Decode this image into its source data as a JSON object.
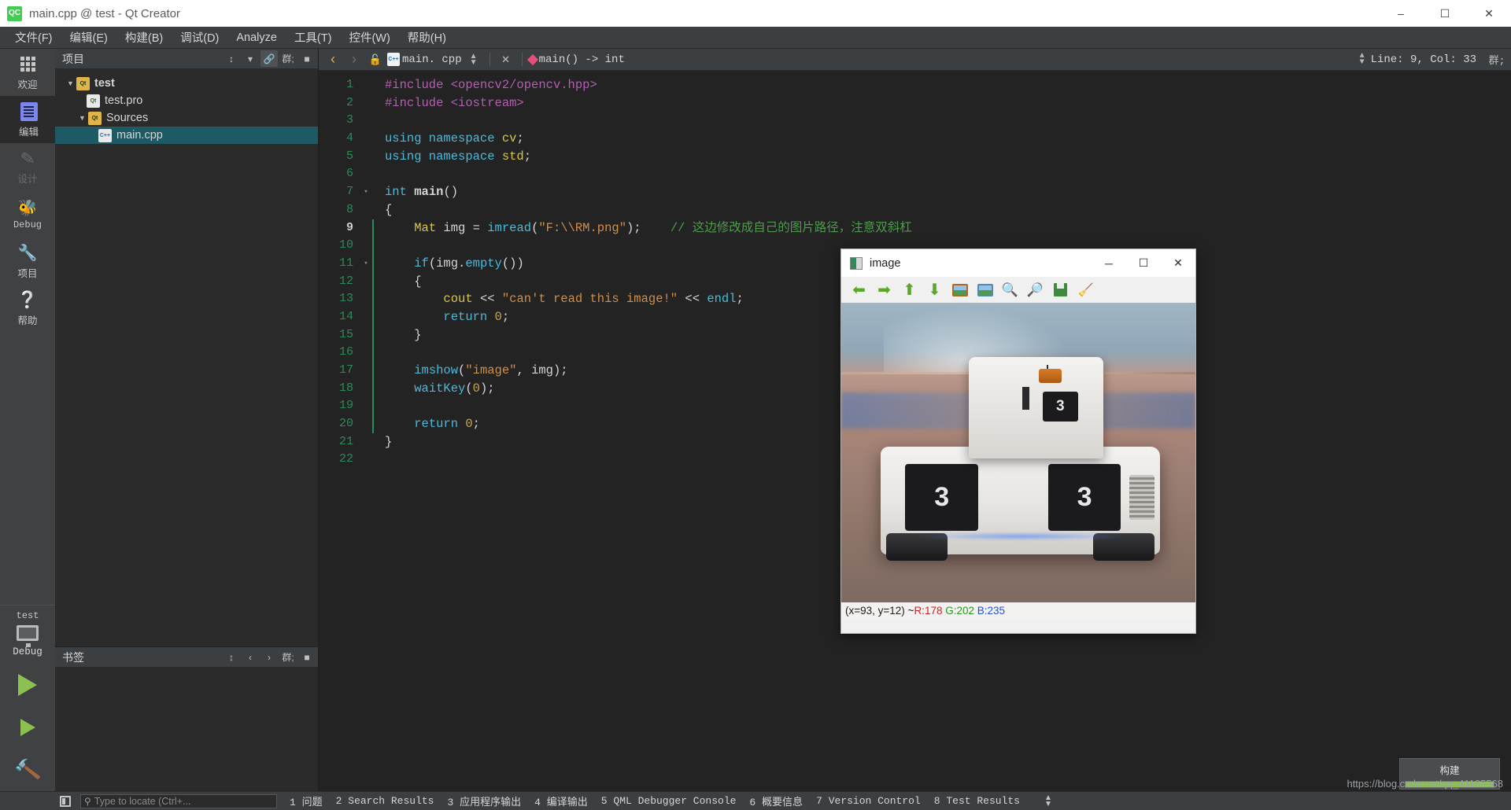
{
  "window": {
    "title": "main.cpp @ test - Qt Creator",
    "logo_text": "QC",
    "minimize": "–",
    "maximize": "☐",
    "close": "✕"
  },
  "menubar": {
    "items": [
      {
        "label": "文件(F)"
      },
      {
        "label": "编辑(E)"
      },
      {
        "label": "构建(B)"
      },
      {
        "label": "调试(D)"
      },
      {
        "label": "Analyze"
      },
      {
        "label": "工具(T)"
      },
      {
        "label": "控件(W)"
      },
      {
        "label": "帮助(H)"
      }
    ]
  },
  "modebar": {
    "modes": [
      {
        "label": "欢迎",
        "icon": "grid-icon",
        "state": "normal"
      },
      {
        "label": "编辑",
        "icon": "edit-icon",
        "state": "active"
      },
      {
        "label": "设计",
        "icon": "pencil-icon",
        "state": "disabled"
      },
      {
        "label": "Debug",
        "icon": "bug-icon",
        "state": "normal"
      },
      {
        "label": "项目",
        "icon": "wrench-icon",
        "state": "normal"
      },
      {
        "label": "帮助",
        "icon": "question-icon",
        "state": "normal"
      }
    ],
    "kit_name": "test",
    "kit_config": "Debug",
    "run_label": "▶",
    "debug_label": "▶",
    "build_label": "ὒ8"
  },
  "project_pane": {
    "header_title": "项目",
    "tree": [
      {
        "label": "test",
        "indent": 0,
        "arrow": "▼",
        "icon": "qt-project-folder-icon",
        "bold": true,
        "selected": false
      },
      {
        "label": "test.pro",
        "indent": 1,
        "arrow": "",
        "icon": "qt-pro-file-icon",
        "bold": false,
        "selected": false
      },
      {
        "label": "Sources",
        "indent": 1,
        "arrow": "▼",
        "icon": "sources-folder-icon",
        "bold": false,
        "selected": false
      },
      {
        "label": "main.cpp",
        "indent": 2,
        "arrow": "",
        "icon": "cpp-file-icon",
        "bold": false,
        "selected": true
      }
    ]
  },
  "bookmarks_pane": {
    "header_title": "书签"
  },
  "editor": {
    "toolbar": {
      "back_arrow": "‹",
      "forward_arrow": "›",
      "lock_icon": "🔓",
      "file_badge": "C++",
      "filename": "main. cpp",
      "close_label": "✕",
      "symbol_label": "main() -> int",
      "line_col": "Line: 9, Col: 33"
    },
    "code": [
      {
        "num": "1",
        "fold": "",
        "current": false,
        "tokens": [
          {
            "t": "#include ",
            "c": "k-pre"
          },
          {
            "t": "<opencv2/opencv.hpp>",
            "c": "k-pre"
          }
        ]
      },
      {
        "num": "2",
        "fold": "",
        "current": false,
        "tokens": [
          {
            "t": "#include ",
            "c": "k-pre"
          },
          {
            "t": "<iostream>",
            "c": "k-pre"
          }
        ]
      },
      {
        "num": "3",
        "fold": "",
        "current": false,
        "tokens": []
      },
      {
        "num": "4",
        "fold": "",
        "current": false,
        "tokens": [
          {
            "t": "using namespace ",
            "c": "k-kw"
          },
          {
            "t": "cv",
            "c": "k-ns"
          },
          {
            "t": ";",
            "c": "k-plain"
          }
        ]
      },
      {
        "num": "5",
        "fold": "",
        "current": false,
        "tokens": [
          {
            "t": "using namespace ",
            "c": "k-kw"
          },
          {
            "t": "std",
            "c": "k-ns"
          },
          {
            "t": ";",
            "c": "k-plain"
          }
        ]
      },
      {
        "num": "6",
        "fold": "",
        "current": false,
        "tokens": []
      },
      {
        "num": "7",
        "fold": "▾",
        "current": false,
        "tokens": [
          {
            "t": "int ",
            "c": "k-kw"
          },
          {
            "t": "main",
            "c": "k-fn"
          },
          {
            "t": "()",
            "c": "k-plain"
          }
        ]
      },
      {
        "num": "8",
        "fold": "",
        "current": false,
        "tokens": [
          {
            "t": "{",
            "c": "k-plain"
          }
        ]
      },
      {
        "num": "9",
        "fold": "",
        "current": true,
        "tokens": [
          {
            "t": "    ",
            "c": "k-plain"
          },
          {
            "t": "Mat",
            "c": "k-ocv"
          },
          {
            "t": " img = ",
            "c": "k-plain"
          },
          {
            "t": "imread",
            "c": "k-kw"
          },
          {
            "t": "(",
            "c": "k-plain"
          },
          {
            "t": "\"F:\\\\RM.png\"",
            "c": "k-str"
          },
          {
            "t": ");    ",
            "c": "k-plain"
          },
          {
            "t": "// 这边修改成自己的图片路径，注意双斜杠",
            "c": "k-cmt"
          }
        ]
      },
      {
        "num": "10",
        "fold": "",
        "current": false,
        "tokens": []
      },
      {
        "num": "11",
        "fold": "▾",
        "current": false,
        "tokens": [
          {
            "t": "    ",
            "c": "k-plain"
          },
          {
            "t": "if",
            "c": "k-kw"
          },
          {
            "t": "(img.",
            "c": "k-plain"
          },
          {
            "t": "empty",
            "c": "k-kw"
          },
          {
            "t": "())",
            "c": "k-plain"
          }
        ]
      },
      {
        "num": "12",
        "fold": "",
        "current": false,
        "tokens": [
          {
            "t": "    {",
            "c": "k-plain"
          }
        ]
      },
      {
        "num": "13",
        "fold": "",
        "current": false,
        "tokens": [
          {
            "t": "        ",
            "c": "k-plain"
          },
          {
            "t": "cout",
            "c": "k-ocv"
          },
          {
            "t": " << ",
            "c": "k-plain"
          },
          {
            "t": "\"can't read this image!\"",
            "c": "k-str"
          },
          {
            "t": " << ",
            "c": "k-plain"
          },
          {
            "t": "endl",
            "c": "k-kw"
          },
          {
            "t": ";",
            "c": "k-plain"
          }
        ]
      },
      {
        "num": "14",
        "fold": "",
        "current": false,
        "tokens": [
          {
            "t": "        ",
            "c": "k-plain"
          },
          {
            "t": "return ",
            "c": "k-kw"
          },
          {
            "t": "0",
            "c": "k-num"
          },
          {
            "t": ";",
            "c": "k-plain"
          }
        ]
      },
      {
        "num": "15",
        "fold": "",
        "current": false,
        "tokens": [
          {
            "t": "    }",
            "c": "k-plain"
          }
        ]
      },
      {
        "num": "16",
        "fold": "",
        "current": false,
        "tokens": []
      },
      {
        "num": "17",
        "fold": "",
        "current": false,
        "tokens": [
          {
            "t": "    ",
            "c": "k-plain"
          },
          {
            "t": "imshow",
            "c": "k-kw"
          },
          {
            "t": "(",
            "c": "k-plain"
          },
          {
            "t": "\"image\"",
            "c": "k-str"
          },
          {
            "t": ", img);",
            "c": "k-plain"
          }
        ]
      },
      {
        "num": "18",
        "fold": "",
        "current": false,
        "tokens": [
          {
            "t": "    ",
            "c": "k-plain"
          },
          {
            "t": "waitKey",
            "c": "k-kw"
          },
          {
            "t": "(",
            "c": "k-plain"
          },
          {
            "t": "0",
            "c": "k-num"
          },
          {
            "t": ");",
            "c": "k-plain"
          }
        ]
      },
      {
        "num": "19",
        "fold": "",
        "current": false,
        "tokens": []
      },
      {
        "num": "20",
        "fold": "",
        "current": false,
        "tokens": [
          {
            "t": "    ",
            "c": "k-plain"
          },
          {
            "t": "return ",
            "c": "k-kw"
          },
          {
            "t": "0",
            "c": "k-num"
          },
          {
            "t": ";",
            "c": "k-plain"
          }
        ]
      },
      {
        "num": "21",
        "fold": "",
        "current": false,
        "tokens": [
          {
            "t": "}",
            "c": "k-plain"
          }
        ]
      },
      {
        "num": "22",
        "fold": "",
        "current": false,
        "tokens": []
      }
    ]
  },
  "cv_window": {
    "title": "image",
    "minimize": "─",
    "maximize": "☐",
    "close": "✕",
    "toolbar": [
      {
        "name": "pan-left-icon",
        "glyph": "⬅"
      },
      {
        "name": "pan-right-icon",
        "glyph": "➡"
      },
      {
        "name": "pan-up-icon",
        "glyph": "⬆"
      },
      {
        "name": "pan-down-icon",
        "glyph": "⬇"
      },
      {
        "name": "fit-image-icon",
        "glyph": ""
      },
      {
        "name": "zoom-region-icon",
        "glyph": ""
      },
      {
        "name": "zoom-in-icon",
        "glyph": "⌕"
      },
      {
        "name": "zoom-out-icon",
        "glyph": "⌕"
      },
      {
        "name": "save-image-icon",
        "glyph": ""
      },
      {
        "name": "properties-icon",
        "glyph": ""
      }
    ],
    "status": {
      "coords": "(x=93, y=12) ~ ",
      "r": "R:178",
      "g": "G:202",
      "b": "B:235"
    },
    "image_numbers": {
      "left": "3",
      "right": "3",
      "turret": "3"
    }
  },
  "statusbar": {
    "locate_placeholder": "Type to locate (Ctrl+...",
    "search_icon": "⚲",
    "panes": [
      {
        "num": "1",
        "label": "问题",
        "cjk": true
      },
      {
        "num": "2",
        "label": "Search Results",
        "cjk": false
      },
      {
        "num": "3",
        "label": "应用程序输出",
        "cjk": true
      },
      {
        "num": "4",
        "label": "编译输出",
        "cjk": true
      },
      {
        "num": "5",
        "label": "QML Debugger Console",
        "cjk": false
      },
      {
        "num": "6",
        "label": "概要信息",
        "cjk": true
      },
      {
        "num": "7",
        "label": "Version Control",
        "cjk": false
      },
      {
        "num": "8",
        "label": "Test Results",
        "cjk": false
      }
    ],
    "build_widget_title": "构建",
    "watermark": "https://blog.csdn.net/qq_41185568"
  },
  "colors": {
    "accent_green": "#8cc152",
    "selection": "#1d5a63",
    "editor_bg": "#232323",
    "chrome": "#3c3f41"
  }
}
